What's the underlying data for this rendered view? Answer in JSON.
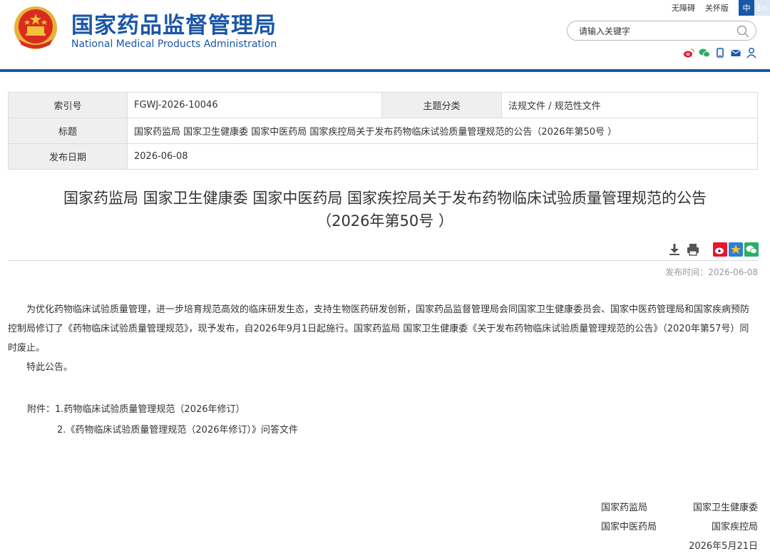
{
  "header": {
    "title_cn": "国家药品监督管理局",
    "title_en": "National Medical Products Administration",
    "top_links": [
      "无障碍",
      "关怀版"
    ],
    "lang": {
      "zh": "中",
      "en": "En"
    },
    "search": {
      "placeholder": "请输入关键字"
    },
    "social_icons": [
      "weibo-icon",
      "wechat-icon",
      "mobile-icon",
      "mail-icon",
      "user-icon"
    ],
    "accent_color": "#1a56a8"
  },
  "info": {
    "index_label": "索引号",
    "index_value": "FGWJ-2026-10046",
    "category_label": "主题分类",
    "category_value": "法规文件 / 规范性文件",
    "title_label": "标题",
    "title_value": "国家药监局 国家卫生健康委 国家中医药局 国家疾控局关于发布药物临床试验质量管理规范的公告（2026年第50号 ）",
    "date_label": "发布日期",
    "date_value": "2026-06-08"
  },
  "article": {
    "title_line1": "国家药监局 国家卫生健康委 国家中医药局 国家疾控局关于发布药物临床试验质量管理规范的公告",
    "title_line2": "（2026年第50号 ）",
    "publish_time": "发布时间：2026-06-08",
    "para1": "为优化药物临床试验质量管理，进一步培育规范高效的临床研发生态，支持生物医药研发创新，国家药品监督管理局会同国家卫生健康委员会、国家中医药管理局和国家疾病预防控制局修订了《药物临床试验质量管理规范》，现予发布，自2026年9月1日起施行。国家药监局 国家卫生健康委《关于发布药物临床试验质量管理规范的公告》（2020年第57号）同时废止。",
    "para2": "特此公告。",
    "attachment_prefix": "附件：",
    "attachments": [
      "1.药物临床试验质量管理规范（2026年修订）",
      "2.《药物临床试验质量管理规范（2026年修订）》问答文件"
    ],
    "signers": [
      [
        "国家药监局",
        "国家卫生健康委"
      ],
      [
        "国家中医药局",
        "国家疾控局"
      ]
    ],
    "sign_date": "2026年5月21日"
  }
}
